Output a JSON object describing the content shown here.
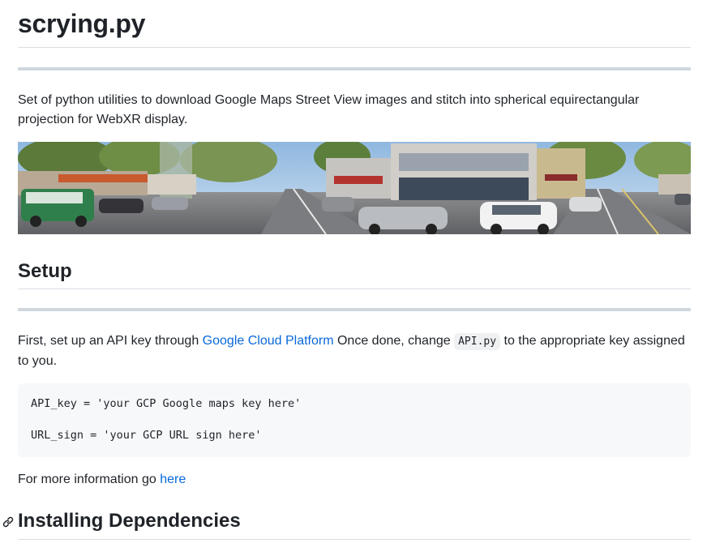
{
  "title": "scrying.py",
  "description": "Set of python utilities to download Google Maps Street View images and stitch into spherical equirectangular projection for WebXR display.",
  "banner": {
    "alt_icon": "street-view-panorama"
  },
  "setup": {
    "heading": "Setup",
    "text_before": "First, set up an API key through ",
    "link_text": "Google Cloud Platform",
    "text_middle": " Once done, change ",
    "inline_code": "API.py",
    "text_after": " to the appropriate key assigned to you."
  },
  "code_block": {
    "lines": [
      "API_key = 'your GCP Google maps key here'",
      "",
      "URL_sign = 'your GCP URL sign here'"
    ]
  },
  "more_info": {
    "text": "For more information go ",
    "link_text": "here"
  },
  "installing": {
    "heading": "Installing Dependencies",
    "icon": "link-icon"
  },
  "colors": {
    "text": "#1f2328",
    "link": "#0969da",
    "rule": "#d8dee4",
    "thick_rule": "#d0d7de",
    "code_bg": "#f6f8fa"
  }
}
